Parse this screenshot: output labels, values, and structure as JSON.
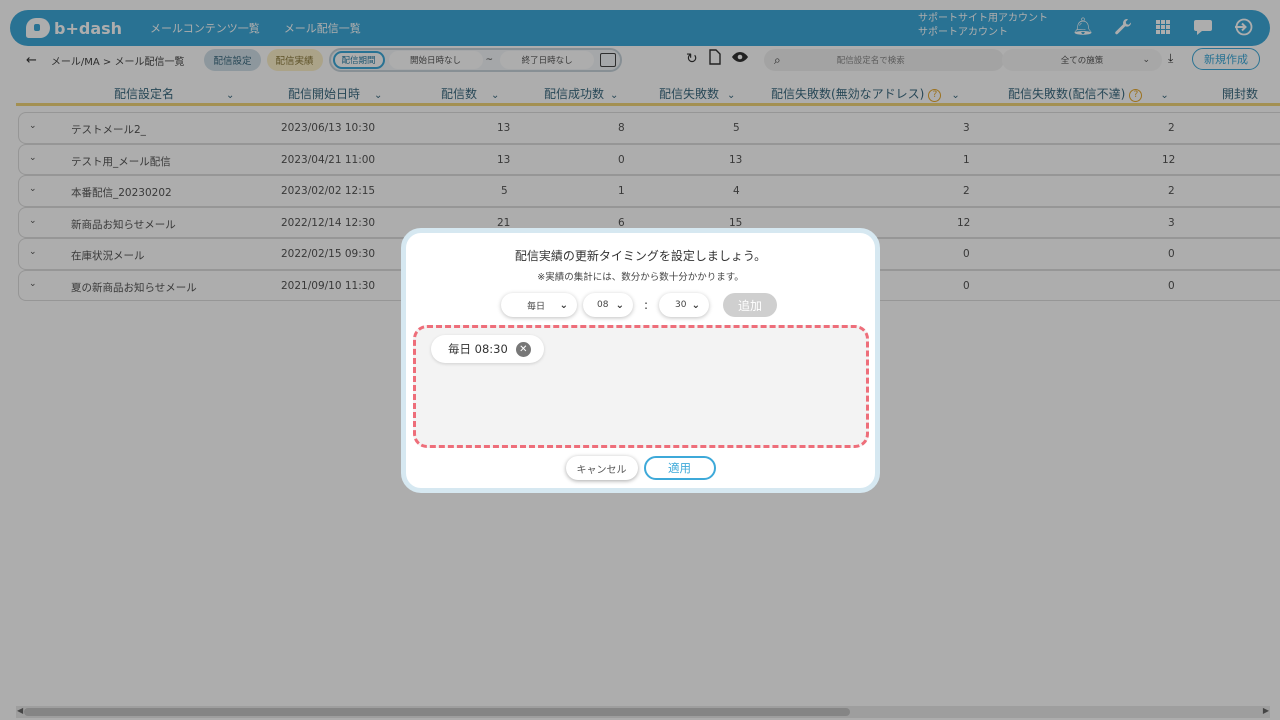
{
  "header": {
    "logo": "b+dash",
    "nav": [
      "メールコンテンツ一覧",
      "メール配信一覧"
    ],
    "account_line1": "サポートサイト用アカウント",
    "account_line2": "サポートアカウント",
    "icons": [
      "bell-icon",
      "wrench-icon",
      "grid-icon",
      "chat-icon",
      "logout-icon"
    ]
  },
  "toolbar": {
    "breadcrumb": "メール/MA > メール配信一覧",
    "tab_settings": "配信設定",
    "tab_results": "配信実績",
    "period_label": "配信期間",
    "start_placeholder": "開始日時なし",
    "tilde": "~",
    "end_placeholder": "終了日時なし",
    "search_placeholder": "配信設定名で検索",
    "measure_select": "全ての施策",
    "new_button": "新規作成"
  },
  "table": {
    "columns": [
      "配信設定名",
      "配信開始日時",
      "配信数",
      "配信成功数",
      "配信失敗数",
      "配信失敗数(無効なアドレス)",
      "配信失敗数(配信不達)",
      "開封数"
    ],
    "rows": [
      {
        "name": "テストメール2_",
        "date": "2023/06/13 10:30",
        "sent": "13",
        "success": "8",
        "fail": "5",
        "invalid": "3",
        "undeliv": "2"
      },
      {
        "name": "テスト用_メール配信",
        "date": "2023/04/21 11:00",
        "sent": "13",
        "success": "0",
        "fail": "13",
        "invalid": "1",
        "undeliv": "12"
      },
      {
        "name": "本番配信_20230202",
        "date": "2023/02/02 12:15",
        "sent": "5",
        "success": "1",
        "fail": "4",
        "invalid": "2",
        "undeliv": "2"
      },
      {
        "name": "新商品お知らせメール",
        "date": "2022/12/14 12:30",
        "sent": "21",
        "success": "6",
        "fail": "15",
        "invalid": "12",
        "undeliv": "3"
      },
      {
        "name": "在庫状況メール",
        "date": "2022/02/15 09:30",
        "sent": "",
        "success": "",
        "fail": "",
        "invalid": "0",
        "undeliv": "0"
      },
      {
        "name": "夏の新商品お知らせメール",
        "date": "2021/09/10 11:30",
        "sent": "",
        "success": "",
        "fail": "",
        "invalid": "0",
        "undeliv": "0"
      }
    ]
  },
  "modal": {
    "title": "配信実績の更新タイミングを設定しましょう。",
    "note": "※実績の集計には、数分から数十分かかります。",
    "frequency": "毎日",
    "hour": "08",
    "colon": ":",
    "minute": "30",
    "add_button": "追加",
    "schedules": [
      "毎日 08:30"
    ],
    "cancel_button": "キャンセル",
    "apply_button": "適用"
  }
}
